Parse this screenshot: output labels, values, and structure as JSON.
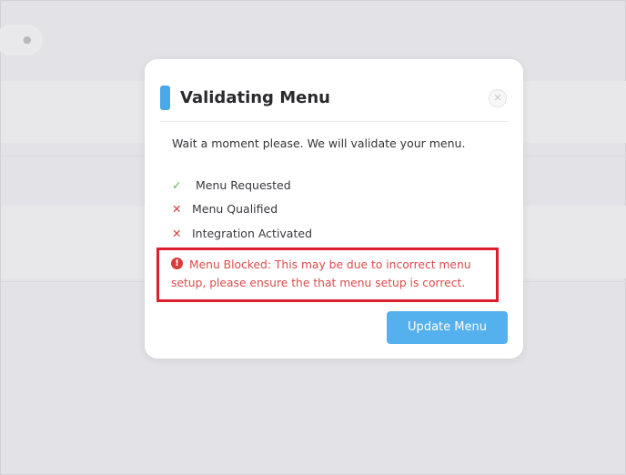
{
  "modal": {
    "title": "Validating Menu",
    "close_icon": "close-icon",
    "intro": "Wait a moment please. We will validate your menu.",
    "steps": [
      {
        "label": "Menu Requested",
        "status": "done",
        "icon": "check-icon",
        "glyph": "✓"
      },
      {
        "label": "Menu Qualified",
        "status": "failed",
        "icon": "cross-icon",
        "glyph": "✕"
      },
      {
        "label": "Integration Activated",
        "status": "failed",
        "icon": "cross-icon",
        "glyph": "✕"
      }
    ],
    "error": {
      "icon": "error-icon",
      "icon_glyph": "!",
      "message": "Menu Blocked: This may be due to incorrect menu setup, please ensure the that menu setup is correct."
    },
    "update_button_label": "Update Menu"
  },
  "colors": {
    "accent": "#4aa8e8",
    "button": "#55b0ee",
    "success": "#52b455",
    "error": "#d63a3a",
    "highlight_border": "#dc1f2e"
  }
}
